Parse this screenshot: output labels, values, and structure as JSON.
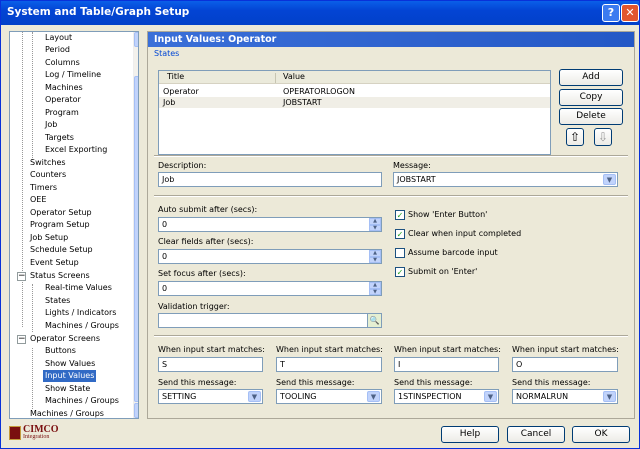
{
  "window": {
    "title": "System and Table/Graph Setup",
    "help_glyph": "?",
    "close_glyph": "✕"
  },
  "tree": {
    "items": [
      {
        "label": "Layout"
      },
      {
        "label": "Period"
      },
      {
        "label": "Columns"
      },
      {
        "label": "Log / Timeline"
      },
      {
        "label": "Machines"
      },
      {
        "label": "Operator"
      },
      {
        "label": "Program"
      },
      {
        "label": "Job"
      },
      {
        "label": "Targets"
      },
      {
        "label": "Excel Exporting"
      },
      {
        "label": "Switches"
      },
      {
        "label": "Counters"
      },
      {
        "label": "Timers"
      },
      {
        "label": "OEE"
      },
      {
        "label": "Operator Setup"
      },
      {
        "label": "Program Setup"
      },
      {
        "label": "Job Setup"
      },
      {
        "label": "Schedule Setup"
      },
      {
        "label": "Event Setup"
      },
      {
        "label": "Status Screens"
      },
      {
        "label": "Real-time Values"
      },
      {
        "label": "States"
      },
      {
        "label": "Lights / Indicators"
      },
      {
        "label": "Machines / Groups"
      },
      {
        "label": "Operator Screens"
      },
      {
        "label": "Buttons"
      },
      {
        "label": "Show Values"
      },
      {
        "label": "Input Values"
      },
      {
        "label": "Show State"
      },
      {
        "label": "Machines / Groups"
      },
      {
        "label": "Machines / Groups"
      }
    ],
    "selected": "Input Values",
    "minus": "−"
  },
  "logo": {
    "line1": "CIMCO",
    "line2": "Integration"
  },
  "panel": {
    "title": "Input Values: Operator",
    "states_group": "States",
    "columns": [
      "Title",
      "Value"
    ],
    "rows": [
      {
        "title": "Operator",
        "value": "OPERATORLOGON"
      },
      {
        "title": "Job",
        "value": "JOBSTART"
      }
    ],
    "buttons": {
      "add": "Add",
      "copy": "Copy",
      "delete": "Delete",
      "up": "⇧",
      "down": "⇩"
    },
    "description_label": "Description:",
    "description_value": "Job",
    "message_label": "Message:",
    "message_value": "JOBSTART",
    "auto_submit_label": "Auto submit after (secs):",
    "auto_submit_value": "0",
    "clear_fields_label": "Clear fields after (secs):",
    "clear_fields_value": "0",
    "set_focus_label": "Set focus after (secs):",
    "set_focus_value": "0",
    "validation_label": "Validation trigger:",
    "validation_value": "",
    "checkboxes": [
      {
        "label": "Show 'Enter Button'",
        "checked": true
      },
      {
        "label": "Clear when input completed",
        "checked": true
      },
      {
        "label": "Assume barcode input",
        "checked": false
      },
      {
        "label": "Submit on 'Enter'",
        "checked": true
      }
    ],
    "matches": [
      {
        "label": "When input start matches:",
        "value": "S",
        "send_label": "Send this message:",
        "send_value": "SETTING"
      },
      {
        "label": "When input start matches:",
        "value": "T",
        "send_label": "Send this message:",
        "send_value": "TOOLING"
      },
      {
        "label": "When input start matches:",
        "value": "I",
        "send_label": "Send this message:",
        "send_value": "1STINSPECTION"
      },
      {
        "label": "When input start matches:",
        "value": "O",
        "send_label": "Send this message:",
        "send_value": "NORMALRUN"
      }
    ]
  },
  "footer": {
    "help": "Help",
    "cancel": "Cancel",
    "ok": "OK"
  },
  "glyphs": {
    "dropdown": "▼",
    "up": "▲",
    "down": "▼",
    "search": "🔍",
    "check": "✓"
  }
}
